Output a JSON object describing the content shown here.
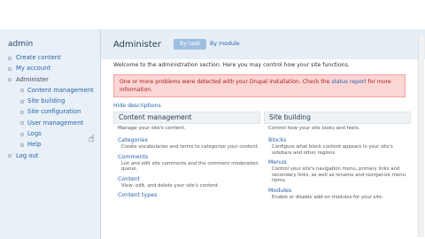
{
  "sidebar": {
    "user": "admin",
    "items": [
      {
        "label": "Create content",
        "level": 0,
        "kind": "link"
      },
      {
        "label": "My account",
        "level": 0,
        "kind": "link"
      },
      {
        "label": "Administer",
        "level": 0,
        "kind": "head"
      },
      {
        "label": "Content management",
        "level": 1,
        "kind": "link"
      },
      {
        "label": "Site building",
        "level": 1,
        "kind": "link"
      },
      {
        "label": "Site configuration",
        "level": 1,
        "kind": "link"
      },
      {
        "label": "User management",
        "level": 1,
        "kind": "link"
      },
      {
        "label": "Logs",
        "level": 1,
        "kind": "link"
      },
      {
        "label": "Help",
        "level": 1,
        "kind": "link"
      },
      {
        "label": "Log out",
        "level": 0,
        "kind": "link"
      }
    ]
  },
  "main": {
    "title": "Administer",
    "tabs": [
      {
        "label": "By task",
        "active": true
      },
      {
        "label": "By module",
        "active": false
      }
    ],
    "welcome": "Welcome to the administration section. Here you may control how your site functions.",
    "alert": {
      "before": "One or more problems were detected with your Drupal installation. Check the ",
      "link": "status report",
      "after": " for more information."
    },
    "hide_descriptions": "Hide descriptions",
    "columns": [
      {
        "title": "Content management",
        "subtitle": "Manage your site's content.",
        "entries": [
          {
            "title": "Categories",
            "desc": "Create vocabularies and terms to categorize your content."
          },
          {
            "title": "Comments",
            "desc": "List and edit site comments and the comment moderation queue."
          },
          {
            "title": "Content",
            "desc": "View, edit, and delete your site's content."
          },
          {
            "title": "Content types",
            "desc": ""
          }
        ]
      },
      {
        "title": "Site building",
        "subtitle": "Control how your site looks and feels.",
        "entries": [
          {
            "title": "Blocks",
            "desc": "Configure what block content appears in your site's sidebars and other regions."
          },
          {
            "title": "Menus",
            "desc": "Control your site's navigation menu, primary links and secondary links, as well as rename and reorganize menu items."
          },
          {
            "title": "Modules",
            "desc": "Enable or disable add-on modules for your site."
          }
        ]
      }
    ]
  },
  "colors": {
    "link": "#2763a8",
    "sidebar_bg": "#e8f0f8",
    "alert_bg": "#fcd5d5",
    "alert_text": "#a31d1d",
    "tab_active_bg": "#9ebfe0"
  },
  "icons": {
    "cursor": "hand-pointer-icon"
  }
}
